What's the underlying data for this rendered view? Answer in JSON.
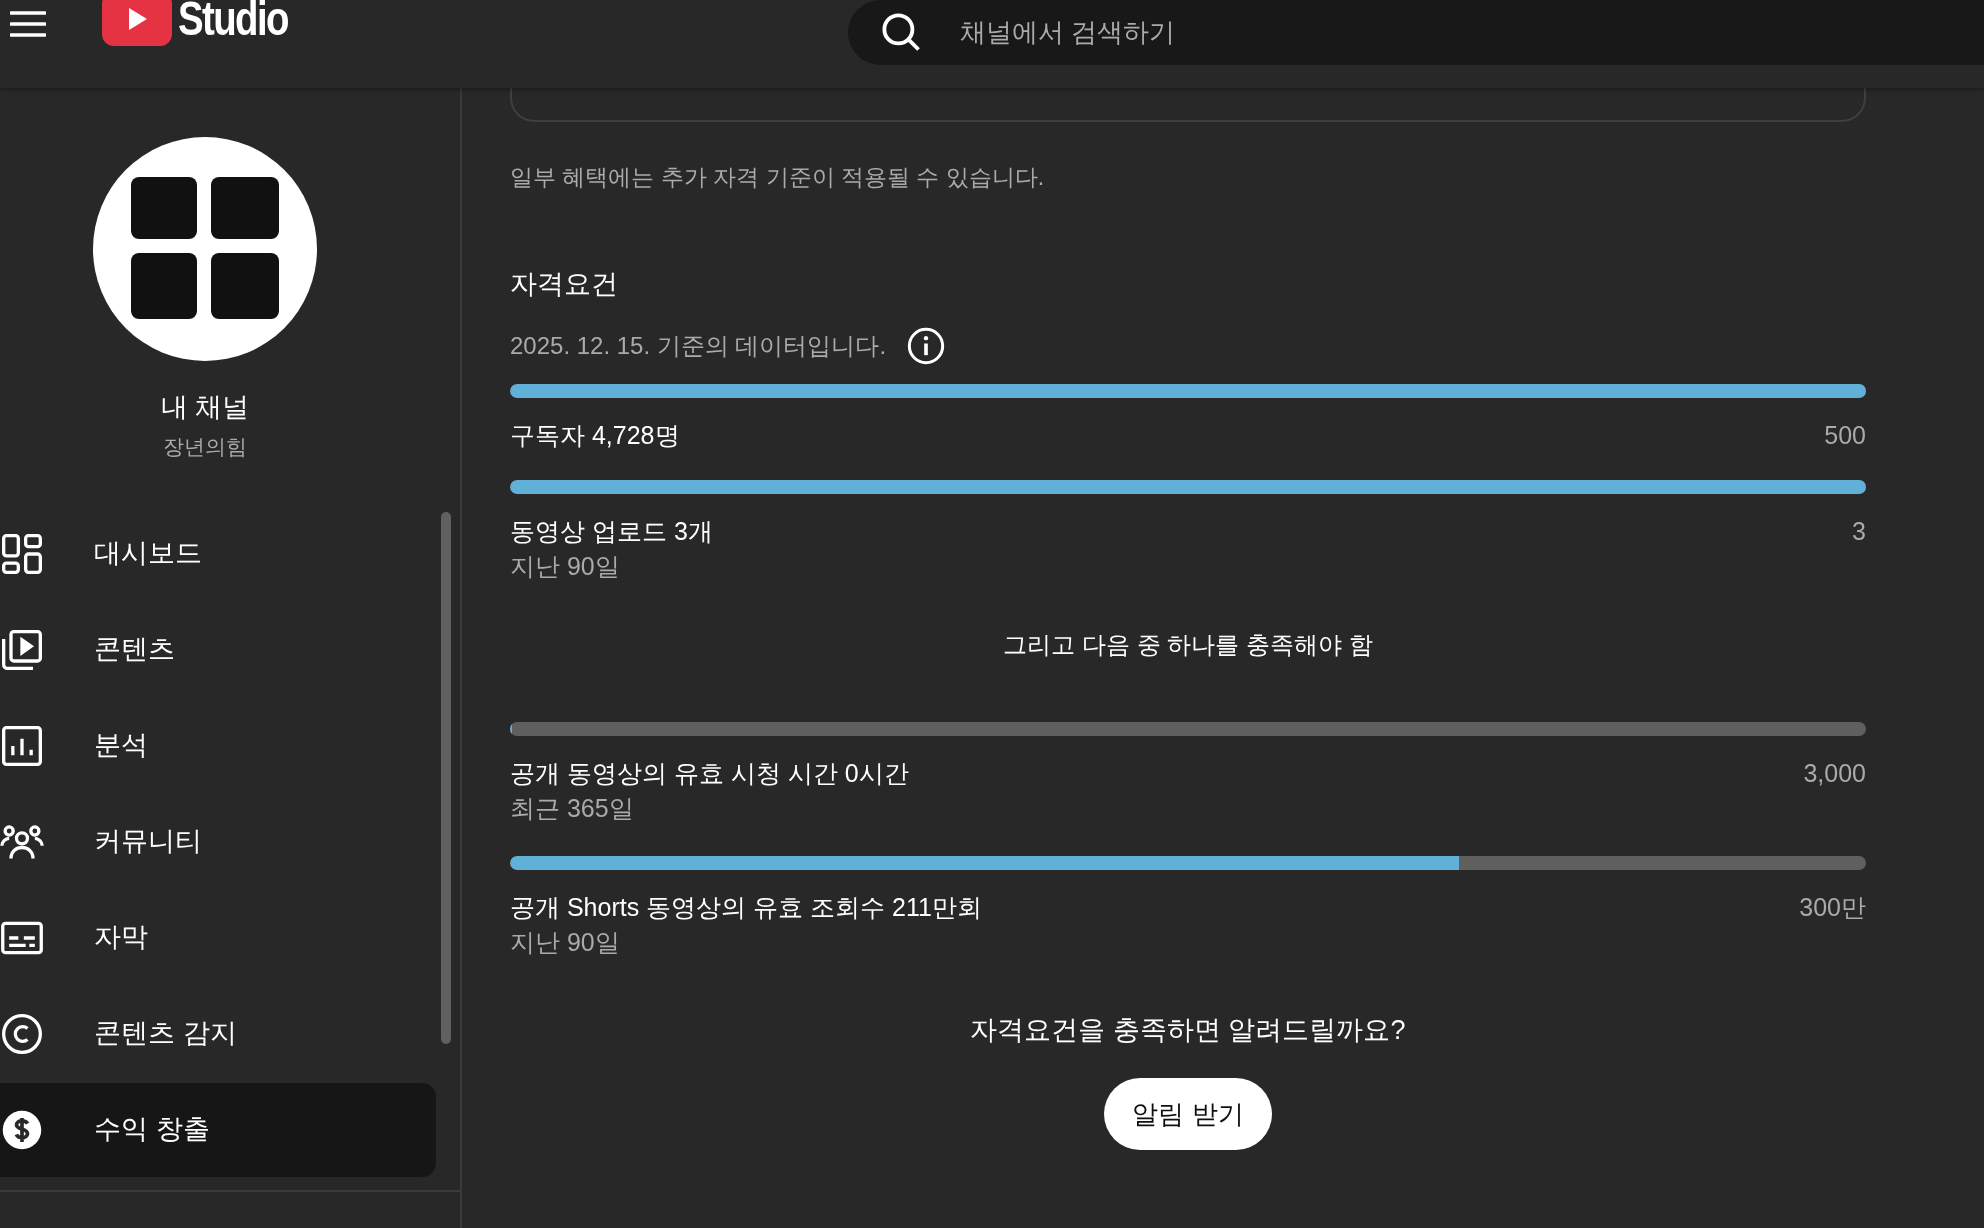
{
  "header": {
    "logo_text": "Studio",
    "search": {
      "placeholder": "채널에서 검색하기"
    }
  },
  "sidebar": {
    "channel_title": "내 채널",
    "channel_name": "장년의힘",
    "items": [
      {
        "label": "대시보드",
        "selected": false
      },
      {
        "label": "콘텐츠",
        "selected": false
      },
      {
        "label": "분석",
        "selected": false
      },
      {
        "label": "커뮤니티",
        "selected": false
      },
      {
        "label": "자막",
        "selected": false
      },
      {
        "label": "콘텐츠 감지",
        "selected": false
      },
      {
        "label": "수익 창출",
        "selected": true
      }
    ]
  },
  "main": {
    "note": "일부 혜택에는 추가 자격 기준이 적용될 수 있습니다.",
    "section_title": "자격요건",
    "data_date": "2025. 12. 15. 기준의 데이터입니다.",
    "requirements": [
      {
        "label": "구독자 4,728명",
        "target": "500",
        "level": 1
      },
      {
        "label": "동영상 업로드 3개",
        "sub": "지난 90일",
        "target": "3",
        "level": 1
      }
    ],
    "divider_text": "그리고 다음 중 하나를 충족해야 함",
    "options": [
      {
        "label": "공개 동영상의 유효 시청 시간 0시간",
        "sub": "최근 365일",
        "target": "3,000",
        "level": 0
      },
      {
        "label": "공개 Shorts 동영상의 유효 조회수 211만회",
        "sub": "지난 90일",
        "target": "300만",
        "level": 0.7
      }
    ],
    "notify_question": "자격요건을 충족하면 알려드릴까요?",
    "notify_button": "알림 받기"
  }
}
